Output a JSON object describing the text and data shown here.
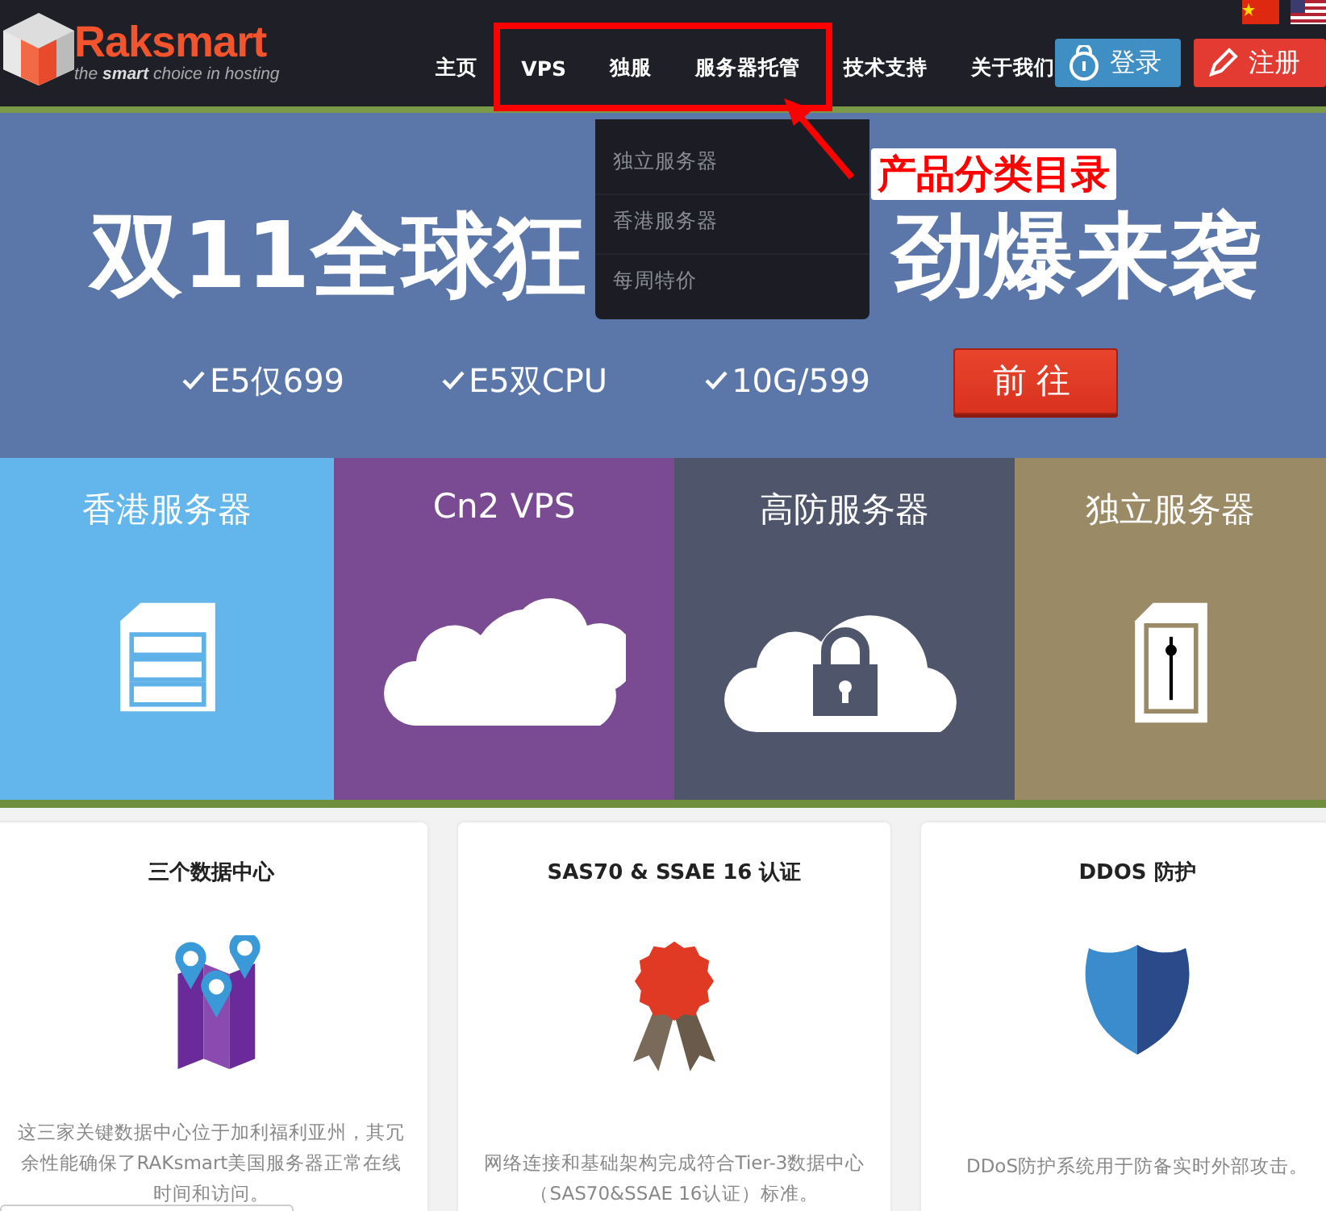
{
  "logo": {
    "name": "Raksmart",
    "tagline": "the **smart** choice in hosting"
  },
  "nav": [
    {
      "label": "主页"
    },
    {
      "label": "VPS"
    },
    {
      "label": "独服"
    },
    {
      "label": "服务器托管",
      "menu": [
        "独立服务器",
        "香港服务器",
        "每周特价"
      ]
    },
    {
      "label": "技术支持"
    },
    {
      "label": "关于我们"
    }
  ],
  "account_buttons": [
    {
      "label": "登录",
      "kind": "login"
    },
    {
      "label": "注册",
      "kind": "register"
    }
  ],
  "hero": {
    "headline_parts": [
      "双11全球狂",
      "劲爆来袭"
    ],
    "features": [
      "E5仅699",
      "E5双CPU",
      "10G/599"
    ],
    "button": "前往"
  },
  "tiles": [
    {
      "title": "香港服务器",
      "kind": "server",
      "color": "#63b6ec"
    },
    {
      "title": "Cn2 VPS",
      "kind": "cloud",
      "color": "#7a4a92"
    },
    {
      "title": "高防服务器",
      "kind": "lock",
      "color": "#4f556b"
    },
    {
      "title": "独立服务器",
      "kind": "tower",
      "color": "#9a8a66"
    }
  ],
  "features": [
    {
      "title": "三个数据中心",
      "kind": "map",
      "text": "这三家关键数据中心位于加利福利亚州，其冗余性能确保了RAKsmart美国服务器正常在线时间和访问。"
    },
    {
      "title": "SAS70 & SSAE 16 认证",
      "kind": "ribbon",
      "text": "网络连接和基础架构完成符合Tier-3数据中心（SAS70&SSAE 16认证）标准。"
    },
    {
      "title": "DDOS 防护",
      "kind": "shield",
      "text": "DDoS防护系统用于防备实时外部攻击。"
    }
  ],
  "annotation": {
    "label": "产品分类目录"
  }
}
